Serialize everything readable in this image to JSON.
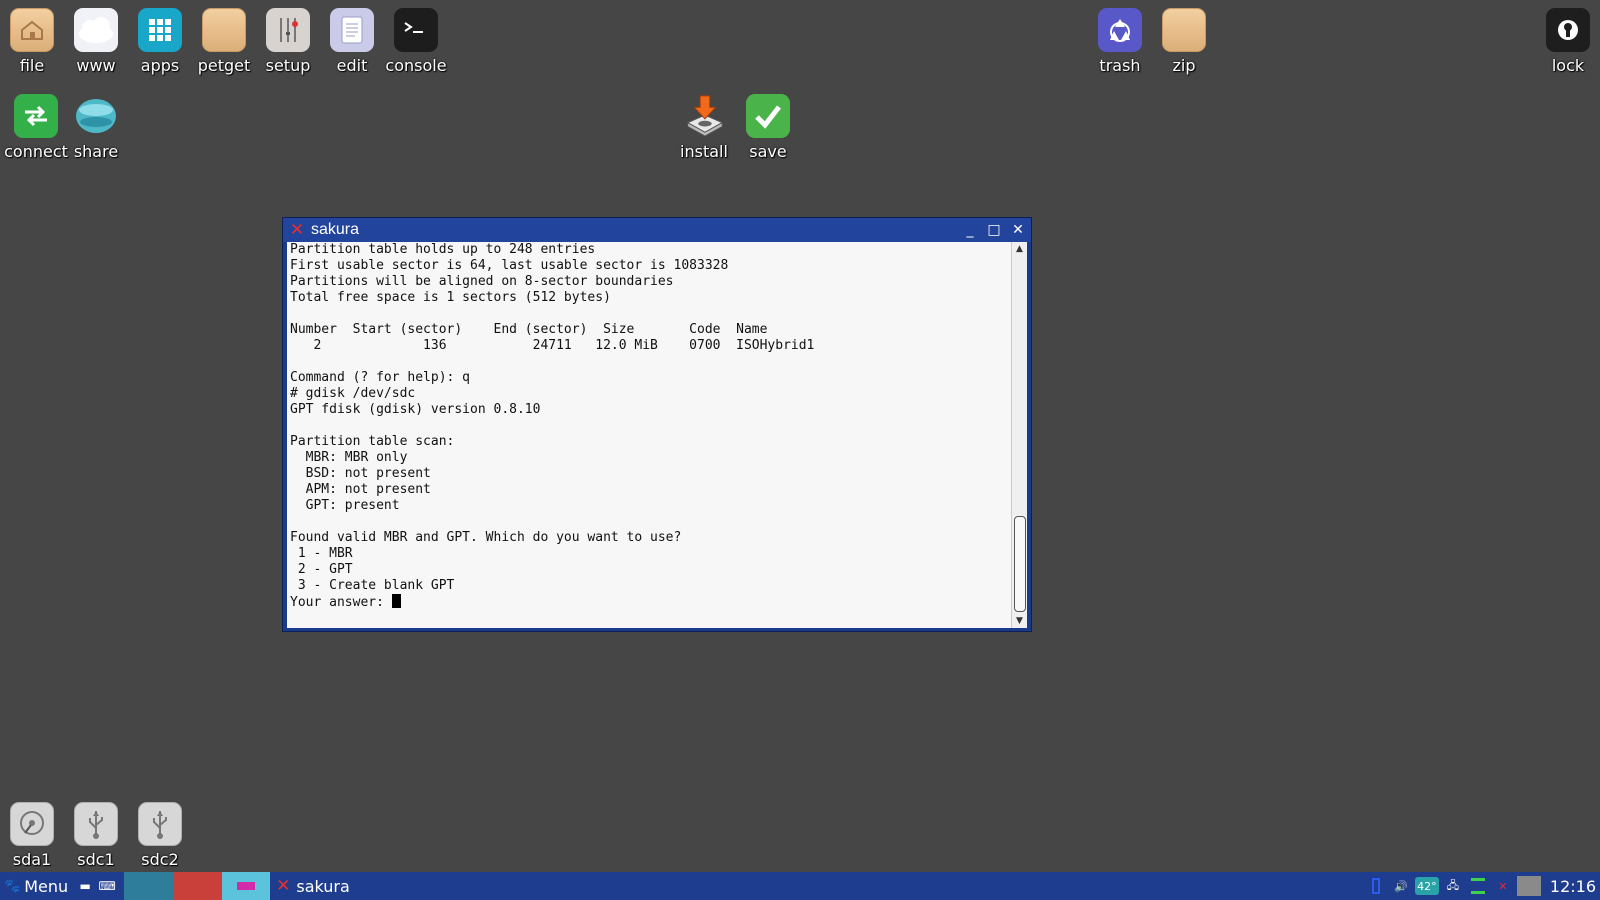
{
  "desktop": {
    "top_left": [
      {
        "name": "file",
        "label": "file",
        "icon": "home-folder-icon"
      },
      {
        "name": "www",
        "label": "www",
        "icon": "cloud-icon"
      },
      {
        "name": "apps",
        "label": "apps",
        "icon": "grid-icon"
      },
      {
        "name": "petget",
        "label": "petget",
        "icon": "folder-icon"
      },
      {
        "name": "setup",
        "label": "setup",
        "icon": "sliders-icon"
      },
      {
        "name": "edit",
        "label": "edit",
        "icon": "document-icon"
      },
      {
        "name": "console",
        "label": "console",
        "icon": "terminal-icon"
      }
    ],
    "row2": [
      {
        "name": "connect",
        "label": "connect",
        "icon": "arrows-icon"
      },
      {
        "name": "share",
        "label": "share",
        "icon": "globe-icon"
      }
    ],
    "center": [
      {
        "name": "install",
        "label": "install",
        "icon": "install-icon"
      },
      {
        "name": "save",
        "label": "save",
        "icon": "checkmark-icon"
      }
    ],
    "top_right": [
      {
        "name": "trash",
        "label": "trash",
        "icon": "recycle-icon"
      },
      {
        "name": "zip",
        "label": "zip",
        "icon": "folder-icon"
      },
      {
        "name": "lock",
        "label": "lock",
        "icon": "keyhole-icon"
      }
    ],
    "drives": [
      {
        "name": "sda1",
        "label": "sda1",
        "icon": "hard-drive-icon"
      },
      {
        "name": "sdc1",
        "label": "sdc1",
        "icon": "usb-icon"
      },
      {
        "name": "sdc2",
        "label": "sdc2",
        "icon": "usb-icon"
      }
    ]
  },
  "window": {
    "title": "sakura",
    "controls": {
      "minimize": "_",
      "maximize": "□",
      "close": "✕"
    }
  },
  "terminal": {
    "lines": [
      "Partition table holds up to 248 entries",
      "First usable sector is 64, last usable sector is 1083328",
      "Partitions will be aligned on 8-sector boundaries",
      "Total free space is 1 sectors (512 bytes)",
      "",
      "Number  Start (sector)    End (sector)  Size       Code  Name",
      "   2             136           24711   12.0 MiB    0700  ISOHybrid1",
      "",
      "Command (? for help): q",
      "# gdisk /dev/sdc",
      "GPT fdisk (gdisk) version 0.8.10",
      "",
      "Partition table scan:",
      "  MBR: MBR only",
      "  BSD: not present",
      "  APM: not present",
      "  GPT: present",
      "",
      "Found valid MBR and GPT. Which do you want to use?",
      " 1 - MBR",
      " 2 - GPT",
      " 3 - Create blank GPT",
      ""
    ],
    "prompt": "Your answer: "
  },
  "taskbar": {
    "menu_label": "Menu",
    "task_label": "sakura",
    "temperature": "42°",
    "clock": "12:16",
    "colors": {
      "bar": "#1f3d8f",
      "ws1": "#2e7d9b",
      "ws2": "#c9403a",
      "ws3": "#5bc4dc"
    }
  }
}
